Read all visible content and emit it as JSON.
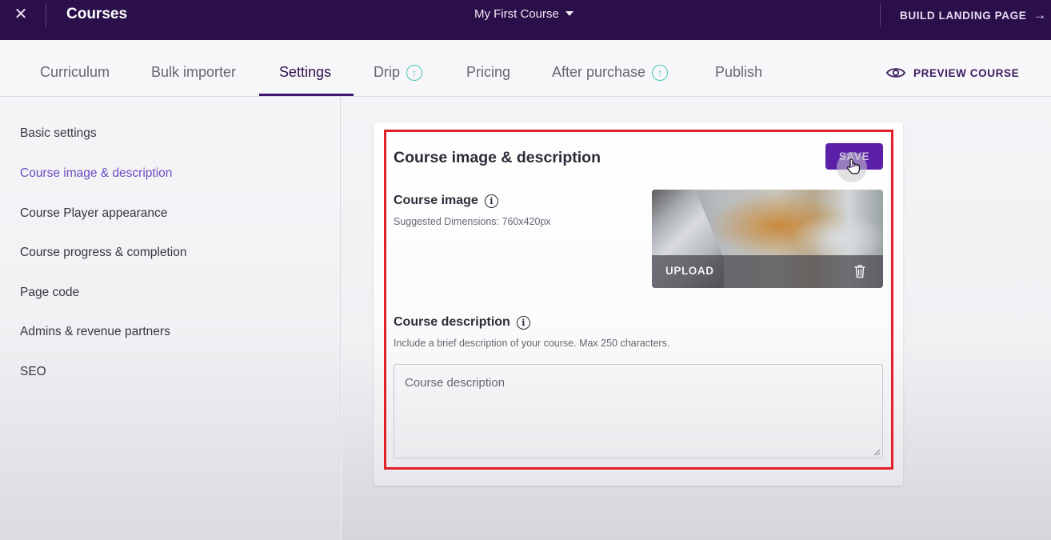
{
  "topbar": {
    "close_glyph": "✕",
    "title": "Courses",
    "course_name": "My First Course",
    "build_label": "BUILD LANDING PAGE",
    "build_arrow": "→",
    "bg_color": "#2b0f4a"
  },
  "tabs": [
    {
      "label": "Curriculum"
    },
    {
      "label": "Bulk importer"
    },
    {
      "label": "Settings",
      "active": true
    },
    {
      "label": "Drip"
    },
    {
      "label": "Pricing"
    },
    {
      "label": "After purchase"
    },
    {
      "label": "Publish"
    }
  ],
  "tab_icon_glyph": "↑",
  "preview_label": "PREVIEW COURSE",
  "sidebar": {
    "items": [
      {
        "label": "Basic settings"
      },
      {
        "label": "Course image & description",
        "active": true
      },
      {
        "label": "Course Player appearance"
      },
      {
        "label": "Course progress & completion"
      },
      {
        "label": "Page code"
      },
      {
        "label": "Admins & revenue partners"
      },
      {
        "label": "SEO"
      }
    ]
  },
  "card": {
    "title": "Course image & description",
    "save_label": "SAVE",
    "image_label": "Course image",
    "image_hint": "Suggested Dimensions: 760x420px",
    "upload_label": "UPLOAD",
    "description_label": "Course description",
    "description_hint": "Include a brief description of your course. Max 250 characters.",
    "description_placeholder": "Course description",
    "info_glyph": "i"
  },
  "colors": {
    "accent": "#5b1fa8",
    "active_link": "#6a4ec0",
    "highlight_border": "#e2202a",
    "tab_icon": "#45c7b4"
  }
}
